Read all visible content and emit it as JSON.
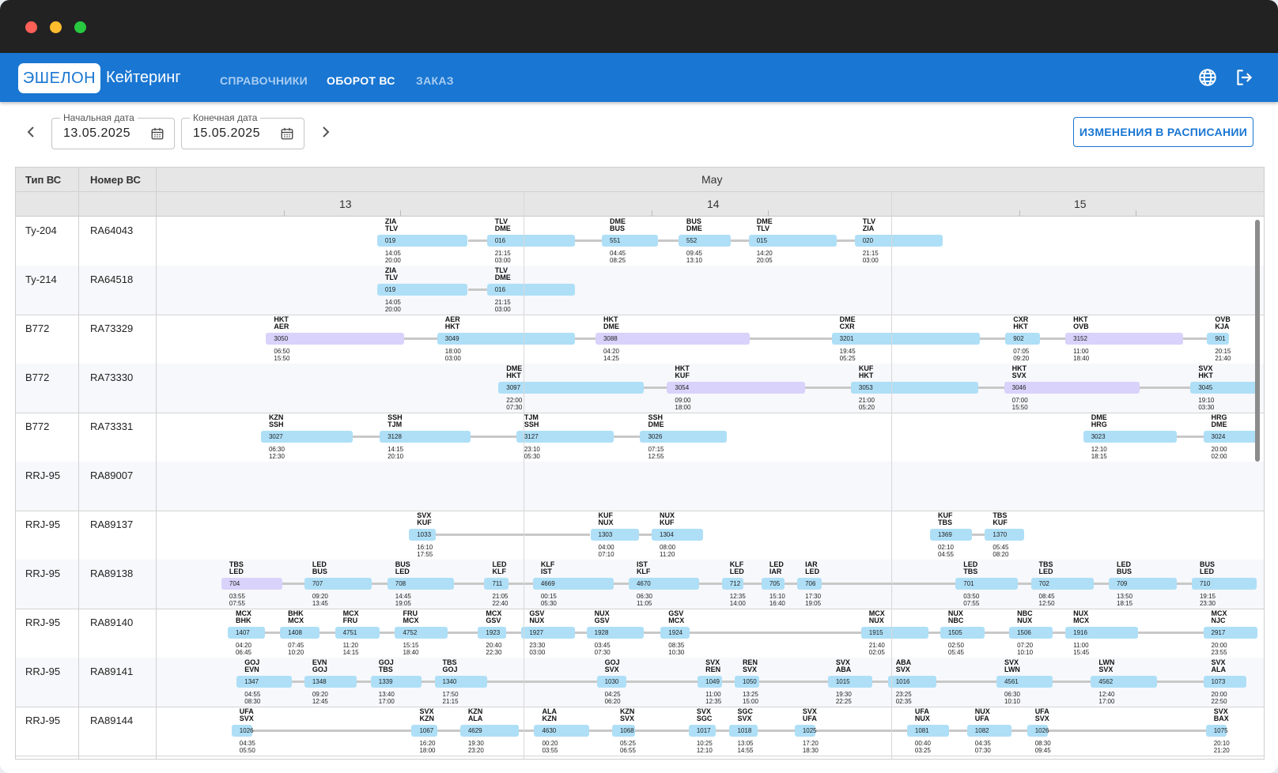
{
  "window": {
    "controls": [
      "close",
      "minimize",
      "maximize"
    ],
    "colors": {
      "close": "#ff5f57",
      "minimize": "#febc2e",
      "maximize": "#28c840"
    }
  },
  "appbar": {
    "logo": "ЭШЕЛОН",
    "app_name": "Кейтеринг",
    "nav": [
      "СПРАВОЧНИКИ",
      "ОБОРОТ ВС",
      "ЗАКАЗ"
    ],
    "active_nav": "ОБОРОТ ВС",
    "icons": [
      "globe-icon",
      "logout-icon"
    ],
    "color": "#1976d2"
  },
  "filters": {
    "start_label": "Начальная дата",
    "start_value": "13.05.2025",
    "end_label": "Конечная дата",
    "end_value": "15.05.2025",
    "schedule_button": "ИЗМЕНЕНИЯ В РАСПИСАНИИ"
  },
  "grid": {
    "col_type": "Тип ВС",
    "col_number": "Номер ВС",
    "month": "May",
    "days": [
      "13",
      "14",
      "15"
    ],
    "rows": [
      {
        "type": "Ту-204",
        "number": "RA64043",
        "flights": [
          {
            "route": "ZIA\nTLV",
            "no": "019",
            "dep": "14:05",
            "arr": "20:00"
          },
          {
            "route": "TLV\nDME",
            "no": "016",
            "dep": "21:15",
            "arr": "03:00"
          },
          {
            "route": "DME\nBUS",
            "no": "551",
            "dep": "04:45",
            "arr": "08:25"
          },
          {
            "route": "BUS\nDME",
            "no": "552",
            "dep": "09:45",
            "arr": "13:10"
          },
          {
            "route": "DME\nTLV",
            "no": "015",
            "dep": "14:20",
            "arr": "20:05"
          },
          {
            "route": "TLV\nZIA",
            "no": "020",
            "dep": "21:15",
            "arr": "03:00"
          }
        ]
      },
      {
        "type": "Ту-214",
        "number": "RA64518",
        "flights": [
          {
            "route": "ZIA\nTLV",
            "no": "019",
            "dep": "14:05",
            "arr": "20:00"
          },
          {
            "route": "TLV\nDME",
            "no": "016",
            "dep": "21:15",
            "arr": "03:00"
          }
        ]
      },
      {
        "type": "B772",
        "number": "RA73329",
        "flights": [
          {
            "route": "HKT\nAER",
            "no": "3050",
            "dep": "06:50",
            "arr": "15:50",
            "color": "purple"
          },
          {
            "route": "AER\nHKT",
            "no": "3049",
            "dep": "18:00",
            "arr": "03:00"
          },
          {
            "route": "HKT\nDME",
            "no": "3088",
            "dep": "04:20",
            "arr": "14:25",
            "color": "purple"
          },
          {
            "route": "DME\nCXR",
            "no": "3201",
            "dep": "19:45",
            "arr": "05:25"
          },
          {
            "route": "CXR\nHKT",
            "no": "902",
            "dep": "07:05",
            "arr": "09:20"
          },
          {
            "route": "HKT\nOVB",
            "no": "3152",
            "dep": "11:00",
            "arr": "18:40",
            "color": "purple"
          },
          {
            "route": "OVB\nKJA",
            "no": "901",
            "dep": "20:15",
            "arr": "21:40"
          }
        ]
      },
      {
        "type": "B772",
        "number": "RA73330",
        "flights": [
          {
            "route": "DME\nHKT",
            "no": "3097",
            "dep": "22:00",
            "arr": "07:30"
          },
          {
            "route": "HKT\nKUF",
            "no": "3054",
            "dep": "09:00",
            "arr": "18:00",
            "color": "purple"
          },
          {
            "route": "KUF\nHKT",
            "no": "3053",
            "dep": "21:00",
            "arr": "05:20"
          },
          {
            "route": "HKT\nSVX",
            "no": "3046",
            "dep": "07:00",
            "arr": "15:50",
            "color": "purple"
          },
          {
            "route": "SVX\nHKT",
            "no": "3045",
            "dep": "19:10",
            "arr": "03:30"
          }
        ]
      },
      {
        "type": "B772",
        "number": "RA73331",
        "flights": [
          {
            "route": "KZN\nSSH",
            "no": "3027",
            "dep": "06:30",
            "arr": "12:30"
          },
          {
            "route": "SSH\nTJM",
            "no": "3128",
            "dep": "14:15",
            "arr": "20:10"
          },
          {
            "route": "TJM\nSSH",
            "no": "3127",
            "dep": "23:10",
            "arr": "05:30"
          },
          {
            "route": "SSH\nDME",
            "no": "3026",
            "dep": "07:15",
            "arr": "12:55"
          },
          {
            "route": "DME\nHRG",
            "no": "3023",
            "dep": "12:10",
            "arr": "18:15"
          },
          {
            "route": "HRG\nDME",
            "no": "3024",
            "dep": "20:00",
            "arr": "02:00"
          }
        ]
      },
      {
        "type": "RRJ-95",
        "number": "RA89007",
        "flights": []
      },
      {
        "type": "RRJ-95",
        "number": "RA89137",
        "flights": [
          {
            "route": "SVX\nKUF",
            "no": "1033",
            "dep": "16:10",
            "arr": "17:55"
          },
          {
            "route": "KUF\nNUX",
            "no": "1303",
            "dep": "04:00",
            "arr": "07:10"
          },
          {
            "route": "NUX\nKUF",
            "no": "1304",
            "dep": "08:00",
            "arr": "11:20"
          },
          {
            "route": "KUF\nTBS",
            "no": "1369",
            "dep": "02:10",
            "arr": "04:55"
          },
          {
            "route": "TBS\nKUF",
            "no": "1370",
            "dep": "05:45",
            "arr": "08:20"
          }
        ]
      },
      {
        "type": "RRJ-95",
        "number": "RA89138",
        "flights": [
          {
            "route": "TBS\nLED",
            "no": "704",
            "dep": "03:55",
            "arr": "07:55",
            "color": "purple"
          },
          {
            "route": "LED\nBUS",
            "no": "707",
            "dep": "09:20",
            "arr": "13:45"
          },
          {
            "route": "BUS\nLED",
            "no": "708",
            "dep": "14:45",
            "arr": "19:05"
          },
          {
            "route": "LED\nKLF",
            "no": "711",
            "dep": "21:05",
            "arr": "22:40"
          },
          {
            "route": "KLF\nIST",
            "no": "4669",
            "dep": "00:15",
            "arr": "05:30"
          },
          {
            "route": "IST\nKLF",
            "no": "4670",
            "dep": "06:30",
            "arr": "11:05"
          },
          {
            "route": "KLF\nLED",
            "no": "712",
            "dep": "12:35",
            "arr": "14:00"
          },
          {
            "route": "LED\nIAR",
            "no": "705",
            "dep": "15:10",
            "arr": "16:40"
          },
          {
            "route": "IAR\nLED",
            "no": "706",
            "dep": "17:30",
            "arr": "19:05"
          },
          {
            "route": "LED\nTBS",
            "no": "701",
            "dep": "03:50",
            "arr": "07:55"
          },
          {
            "route": "TBS\nLED",
            "no": "702",
            "dep": "08:45",
            "arr": "12:50"
          },
          {
            "route": "LED\nBUS",
            "no": "709",
            "dep": "13:50",
            "arr": "18:15"
          },
          {
            "route": "BUS\nLED",
            "no": "710",
            "dep": "19:15",
            "arr": "23:30"
          }
        ]
      },
      {
        "type": "RRJ-95",
        "number": "RA89140",
        "flights": [
          {
            "route": "MCX\nBHK",
            "no": "1407",
            "dep": "04:20",
            "arr": "06:45"
          },
          {
            "route": "BHK\nMCX",
            "no": "1408",
            "dep": "07:45",
            "arr": "10:20"
          },
          {
            "route": "MCX\nFRU",
            "no": "4751",
            "dep": "11:20",
            "arr": "14:15"
          },
          {
            "route": "FRU\nMCX",
            "no": "4752",
            "dep": "15:15",
            "arr": "18:40"
          },
          {
            "route": "MCX\nGSV",
            "no": "1923",
            "dep": "20:40",
            "arr": "22:30"
          },
          {
            "route": "GSV\nNUX",
            "no": "1927",
            "dep": "23:30",
            "arr": "03:00"
          },
          {
            "route": "NUX\nGSV",
            "no": "1928",
            "dep": "03:45",
            "arr": "07:30"
          },
          {
            "route": "GSV\nMCX",
            "no": "1924",
            "dep": "08:35",
            "arr": "10:30"
          },
          {
            "route": "MCX\nNUX",
            "no": "1915",
            "dep": "21:40",
            "arr": "02:05"
          },
          {
            "route": "NUX\nNBC",
            "no": "1505",
            "dep": "02:50",
            "arr": "05:45"
          },
          {
            "route": "NBC\nNUX",
            "no": "1506",
            "dep": "07:20",
            "arr": "10:10"
          },
          {
            "route": "NUX\nMCX",
            "no": "1916",
            "dep": "11:00",
            "arr": "15:45"
          },
          {
            "route": "MCX\nNJC",
            "no": "2917",
            "dep": "20:00",
            "arr": "23:55"
          }
        ]
      },
      {
        "type": "RRJ-95",
        "number": "RA89141",
        "flights": [
          {
            "route": "GOJ\nEVN",
            "no": "1347",
            "dep": "04:55",
            "arr": "08:30"
          },
          {
            "route": "EVN\nGOJ",
            "no": "1348",
            "dep": "09:20",
            "arr": "12:45"
          },
          {
            "route": "GOJ\nTBS",
            "no": "1339",
            "dep": "13:40",
            "arr": "17:00"
          },
          {
            "route": "TBS\nGOJ",
            "no": "1340",
            "dep": "17:50",
            "arr": "21:15"
          },
          {
            "route": "GOJ\nSVX",
            "no": "1030",
            "dep": "04:25",
            "arr": "06:20"
          },
          {
            "route": "SVX\nREN",
            "no": "1049",
            "dep": "11:00",
            "arr": "12:35"
          },
          {
            "route": "REN\nSVX",
            "no": "1050",
            "dep": "13:25",
            "arr": "15:00"
          },
          {
            "route": "SVX\nABA",
            "no": "1015",
            "dep": "19:30",
            "arr": "22:25"
          },
          {
            "route": "ABA\nSVX",
            "no": "1016",
            "dep": "23:25",
            "arr": "02:35"
          },
          {
            "route": "SVX\nLWN",
            "no": "4561",
            "dep": "06:30",
            "arr": "10:10"
          },
          {
            "route": "LWN\nSVX",
            "no": "4562",
            "dep": "12:40",
            "arr": "17:00"
          },
          {
            "route": "SVX\nALA",
            "no": "1073",
            "dep": "20:00",
            "arr": "22:50"
          }
        ]
      },
      {
        "type": "RRJ-95",
        "number": "RA89144",
        "flights": [
          {
            "route": "UFA\nSVX",
            "no": "1026",
            "dep": "04:35",
            "arr": "05:50"
          },
          {
            "route": "SVX\nKZN",
            "no": "1067",
            "dep": "16:20",
            "arr": "18:00"
          },
          {
            "route": "KZN\nALA",
            "no": "4629",
            "dep": "19:30",
            "arr": "23:20"
          },
          {
            "route": "ALA\nKZN",
            "no": "4630",
            "dep": "00:20",
            "arr": "03:55"
          },
          {
            "route": "KZN\nSVX",
            "no": "1068",
            "dep": "05:25",
            "arr": "06:55"
          },
          {
            "route": "SVX\nSGC",
            "no": "1017",
            "dep": "10:25",
            "arr": "12:10"
          },
          {
            "route": "SGC\nSVX",
            "no": "1018",
            "dep": "13:05",
            "arr": "14:55"
          },
          {
            "route": "SVX\nUFA",
            "no": "1025",
            "dep": "17:20",
            "arr": "18:30"
          },
          {
            "route": "UFA\nNUX",
            "no": "1081",
            "dep": "00:40",
            "arr": "03:25"
          },
          {
            "route": "NUX\nUFA",
            "no": "1082",
            "dep": "04:35",
            "arr": "07:30"
          },
          {
            "route": "UFA\nSVX",
            "no": "1026",
            "dep": "08:30",
            "arr": "09:45"
          },
          {
            "route": "SVX\nBAX",
            "no": "1075",
            "dep": "20:10",
            "arr": "21:20"
          }
        ]
      }
    ]
  }
}
